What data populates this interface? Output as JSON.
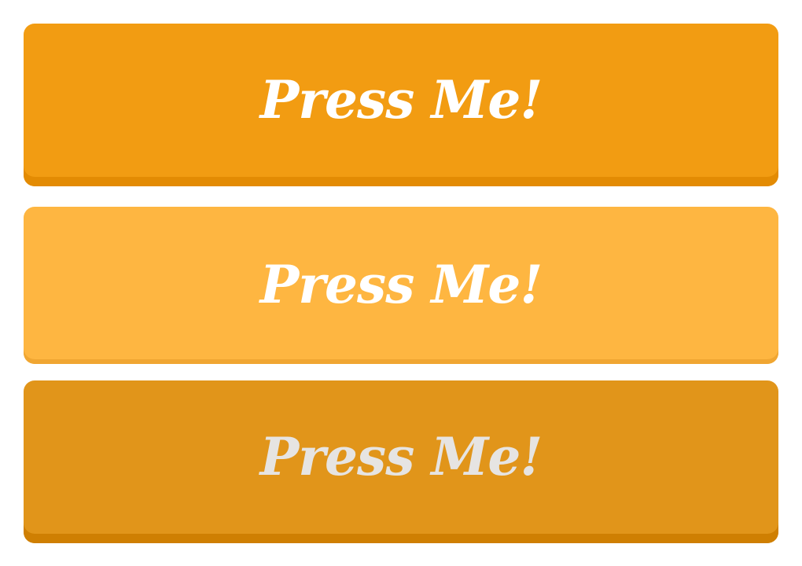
{
  "buttons": [
    {
      "state": "normal",
      "label": "Press Me!",
      "bg_color": "#f29c12",
      "shadow_color": "#e38b03",
      "text_color": "#ffffff"
    },
    {
      "state": "hover",
      "label": "Press Me!",
      "bg_color": "#feb641",
      "shadow_color": "#f0a632",
      "text_color": "#ffffff"
    },
    {
      "state": "active",
      "label": "Press Me!",
      "bg_color": "#e1951a",
      "shadow_color": "#cf7f02",
      "text_color": "#e6e4e2"
    }
  ]
}
